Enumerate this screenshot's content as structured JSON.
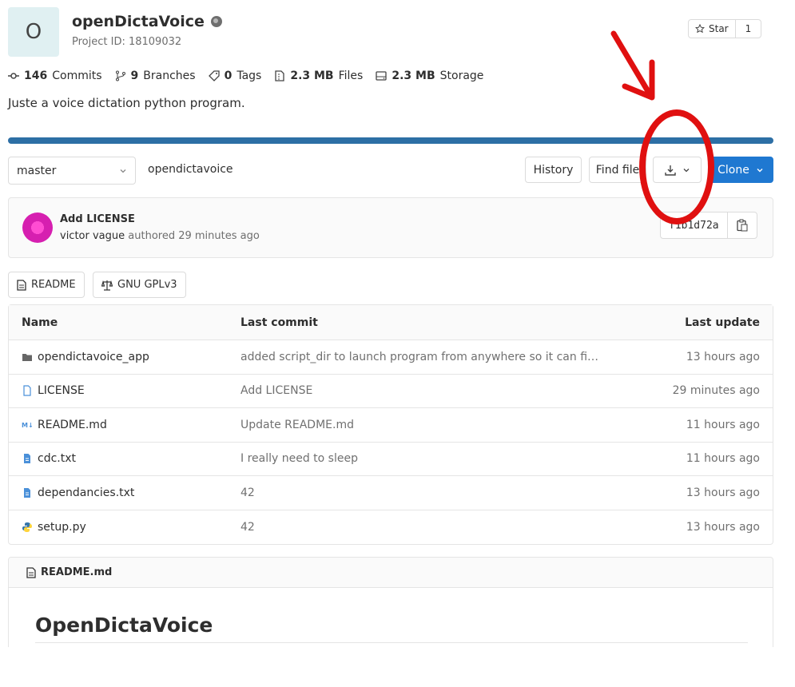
{
  "project": {
    "avatar_letter": "O",
    "name": "openDictaVoice",
    "id_text": "Project ID: 18109032",
    "description": "Juste a voice dictation python program.",
    "star_label": "Star",
    "star_count": "1"
  },
  "stats": {
    "commits_count": "146",
    "commits_label": "Commits",
    "branches_count": "9",
    "branches_label": "Branches",
    "tags_count": "0",
    "tags_label": "Tags",
    "files_size": "2.3 MB",
    "files_label": "Files",
    "storage_size": "2.3 MB",
    "storage_label": "Storage"
  },
  "toolbar": {
    "branch": "master",
    "path": "opendictavoice",
    "history_label": "History",
    "find_file_label": "Find file",
    "clone_label": "Clone"
  },
  "last_commit": {
    "title": "Add LICENSE",
    "author": "victor vague",
    "authored_text": "authored 29 minutes ago",
    "sha": "f1b1d72a"
  },
  "badges": {
    "readme_label": "README",
    "license_label": "GNU GPLv3"
  },
  "tree": {
    "headers": {
      "name": "Name",
      "last_commit": "Last commit",
      "last_update": "Last update"
    },
    "rows": [
      {
        "name": "opendictavoice_app",
        "icon": "folder-icon",
        "commit": "added script_dir to launch program from anywhere so it can find a...",
        "updated": "13 hours ago"
      },
      {
        "name": "LICENSE",
        "icon": "file-icon",
        "commit": "Add LICENSE",
        "updated": "29 minutes ago"
      },
      {
        "name": "README.md",
        "icon": "markdown-icon",
        "commit": "Update README.md",
        "updated": "11 hours ago"
      },
      {
        "name": "cdc.txt",
        "icon": "text-file-icon",
        "commit": "I really need to sleep",
        "updated": "11 hours ago"
      },
      {
        "name": "dependancies.txt",
        "icon": "text-file-icon",
        "commit": "42",
        "updated": "13 hours ago"
      },
      {
        "name": "setup.py",
        "icon": "python-icon",
        "commit": "42",
        "updated": "13 hours ago"
      }
    ]
  },
  "readme": {
    "filename": "README.md",
    "heading": "OpenDictaVoice"
  },
  "colors": {
    "accent": "#1f78d1",
    "progress": "#2d6fa5",
    "annotation": "#e01010"
  }
}
